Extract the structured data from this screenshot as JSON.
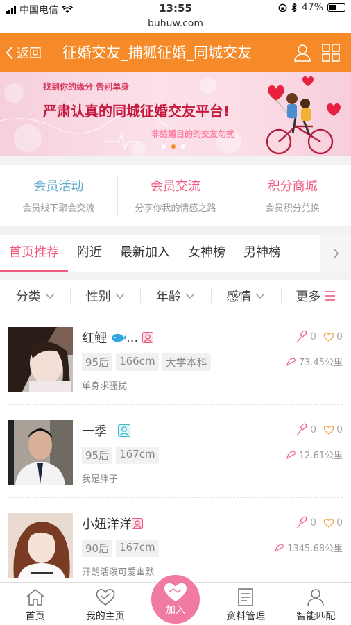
{
  "status_bar": {
    "carrier": "中国电信",
    "time": "13:55",
    "battery": "47%"
  },
  "url": "buhuw.com",
  "header": {
    "back_label": "返回",
    "title": "征婚交友_捕狐征婚_同城交友"
  },
  "banner": {
    "line1": "找到你的缘分  告别单身",
    "line2": "严肃认真的同城征婚交友平台!",
    "line3": "非结婚目的的交友勿扰"
  },
  "cards": [
    {
      "title": "会员活动",
      "sub": "会员线下聚会交流",
      "color": "#5aa9c7"
    },
    {
      "title": "会员交流",
      "sub": "分享你我的情感之路",
      "color": "#ef5a81"
    },
    {
      "title": "积分商城",
      "sub": "会员积分兑换",
      "color": "#ef5a81"
    }
  ],
  "tabs": [
    "首页推荐",
    "附近",
    "最新加入",
    "女神榜",
    "男神榜"
  ],
  "filters": [
    "分类",
    "性别",
    "年龄",
    "感情",
    "更多"
  ],
  "members": [
    {
      "name": "红鲤",
      "ellipsis": "...",
      "tags": [
        "95后",
        "166cm",
        "大学本科"
      ],
      "desc": "单身求骚扰",
      "likes": "0",
      "hearts": "0",
      "distance": "73.45公里"
    },
    {
      "name": "一季",
      "ellipsis": "",
      "tags": [
        "95后",
        "167cm"
      ],
      "desc": "我是胖子",
      "likes": "0",
      "hearts": "0",
      "distance": "12.61公里"
    },
    {
      "name": "小妞洋洋",
      "ellipsis": "",
      "tags": [
        "90后",
        "167cm"
      ],
      "desc": "开朗活泼可爱幽默",
      "likes": "0",
      "hearts": "0",
      "distance": "1345.68公里"
    }
  ],
  "bottom_nav": {
    "home": "首页",
    "my_page": "我的主页",
    "join": "加入",
    "profile": "资料管理",
    "match": "智能匹配"
  },
  "colors": {
    "orange": "#f68a28",
    "pink": "#ef5a81"
  }
}
